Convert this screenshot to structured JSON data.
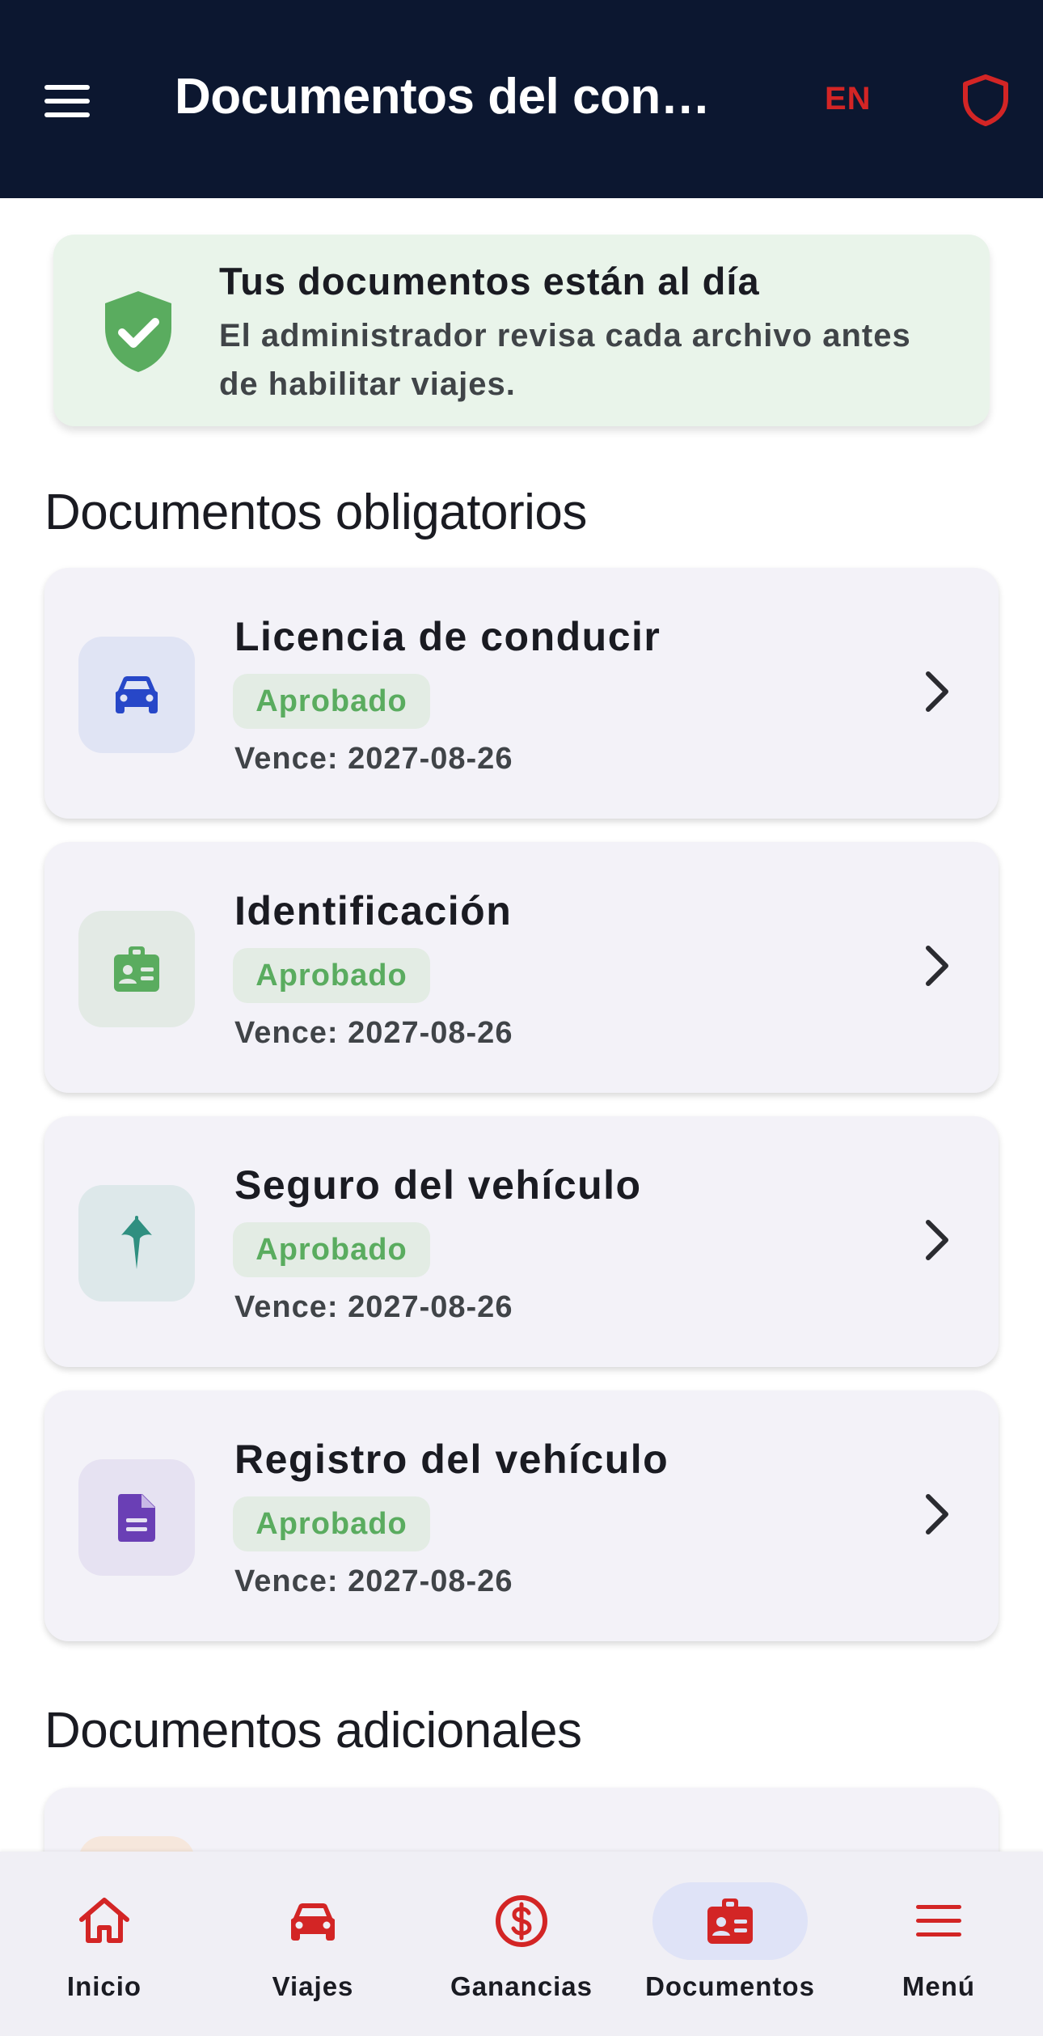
{
  "header": {
    "title": "Documentos del con…",
    "language": "EN"
  },
  "status": {
    "title": "Tus documentos están al día",
    "description": "El administrador revisa cada archivo antes de habilitar viajes."
  },
  "sections": {
    "required": "Documentos obligatorios",
    "additional": "Documentos adicionales"
  },
  "documents": [
    {
      "name": "Licencia de conducir",
      "status": "Aprobado",
      "expiry": "Vence: 2027-08-26",
      "icon": "car-icon"
    },
    {
      "name": "Identificación",
      "status": "Aprobado",
      "expiry": "Vence: 2027-08-26",
      "icon": "id-badge-icon"
    },
    {
      "name": "Seguro del vehículo",
      "status": "Aprobado",
      "expiry": "Vence: 2027-08-26",
      "icon": "umbrella-icon"
    },
    {
      "name": "Registro del vehículo",
      "status": "Aprobado",
      "expiry": "Vence: 2027-08-26",
      "icon": "document-icon"
    }
  ],
  "nav": [
    {
      "label": "Inicio",
      "icon": "home-icon"
    },
    {
      "label": "Viajes",
      "icon": "car-icon"
    },
    {
      "label": "Ganancias",
      "icon": "dollar-icon"
    },
    {
      "label": "Documentos",
      "icon": "id-badge-icon",
      "active": true
    },
    {
      "label": "Menú",
      "icon": "menu-icon"
    }
  ],
  "colors": {
    "header_bg": "#0c1730",
    "accent_red": "#d32525",
    "approved_green": "#5aac5f",
    "card_bg": "#f3f2f8"
  }
}
